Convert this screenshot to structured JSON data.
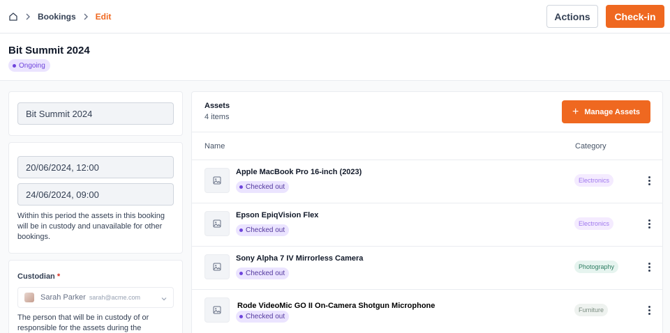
{
  "breadcrumb": {
    "home_icon": "home-icon",
    "items": [
      "Bookings",
      "Edit"
    ]
  },
  "actions": {
    "actions_label": "Actions",
    "checkin_label": "Check-in"
  },
  "booking": {
    "title": "Bit Summit 2024",
    "status": "Ongoing"
  },
  "form": {
    "name_value": "Bit Summit 2024",
    "start_value": "20/06/2024, 12:00",
    "end_value": "24/06/2024, 09:00",
    "period_help": "Within this period the assets in this booking will be in custody and unavailable for other bookings.",
    "custodian_label": "Custodian",
    "required_mark": "*",
    "custodian_name": "Sarah Parker",
    "custodian_email": "sarah@acme.com",
    "custodian_help": "The person that will be in custody of or responsible for the assets during the"
  },
  "assets": {
    "title": "Assets",
    "count": "4 items",
    "manage_label": "Manage Assets",
    "columns": {
      "name": "Name",
      "category": "Category"
    },
    "rows": [
      {
        "name": "Apple MacBook Pro 16-inch (2023)",
        "status": "Checked out",
        "category": "Electronics"
      },
      {
        "name": "Epson EpiqVision Flex",
        "status": "Checked out",
        "category": "Electronics"
      },
      {
        "name": "Sony Alpha 7 IV Mirrorless Camera",
        "status": "Checked out",
        "category": "Photography"
      },
      {
        "name": "Rode VideoMic GO II On-Camera Shotgun Microphone",
        "status": "Checked out",
        "category": "Furniture"
      }
    ]
  },
  "colors": {
    "accent": "#ef6820",
    "status_purple_bg": "#ebe4ff",
    "electronics_bg": "#f4ebff",
    "electronics_fg": "#9e77ed",
    "photography_bg": "#e6f4ef",
    "photography_fg": "#2e7d62",
    "furniture_bg": "#eef2ef",
    "furniture_fg": "#7a8c80"
  }
}
